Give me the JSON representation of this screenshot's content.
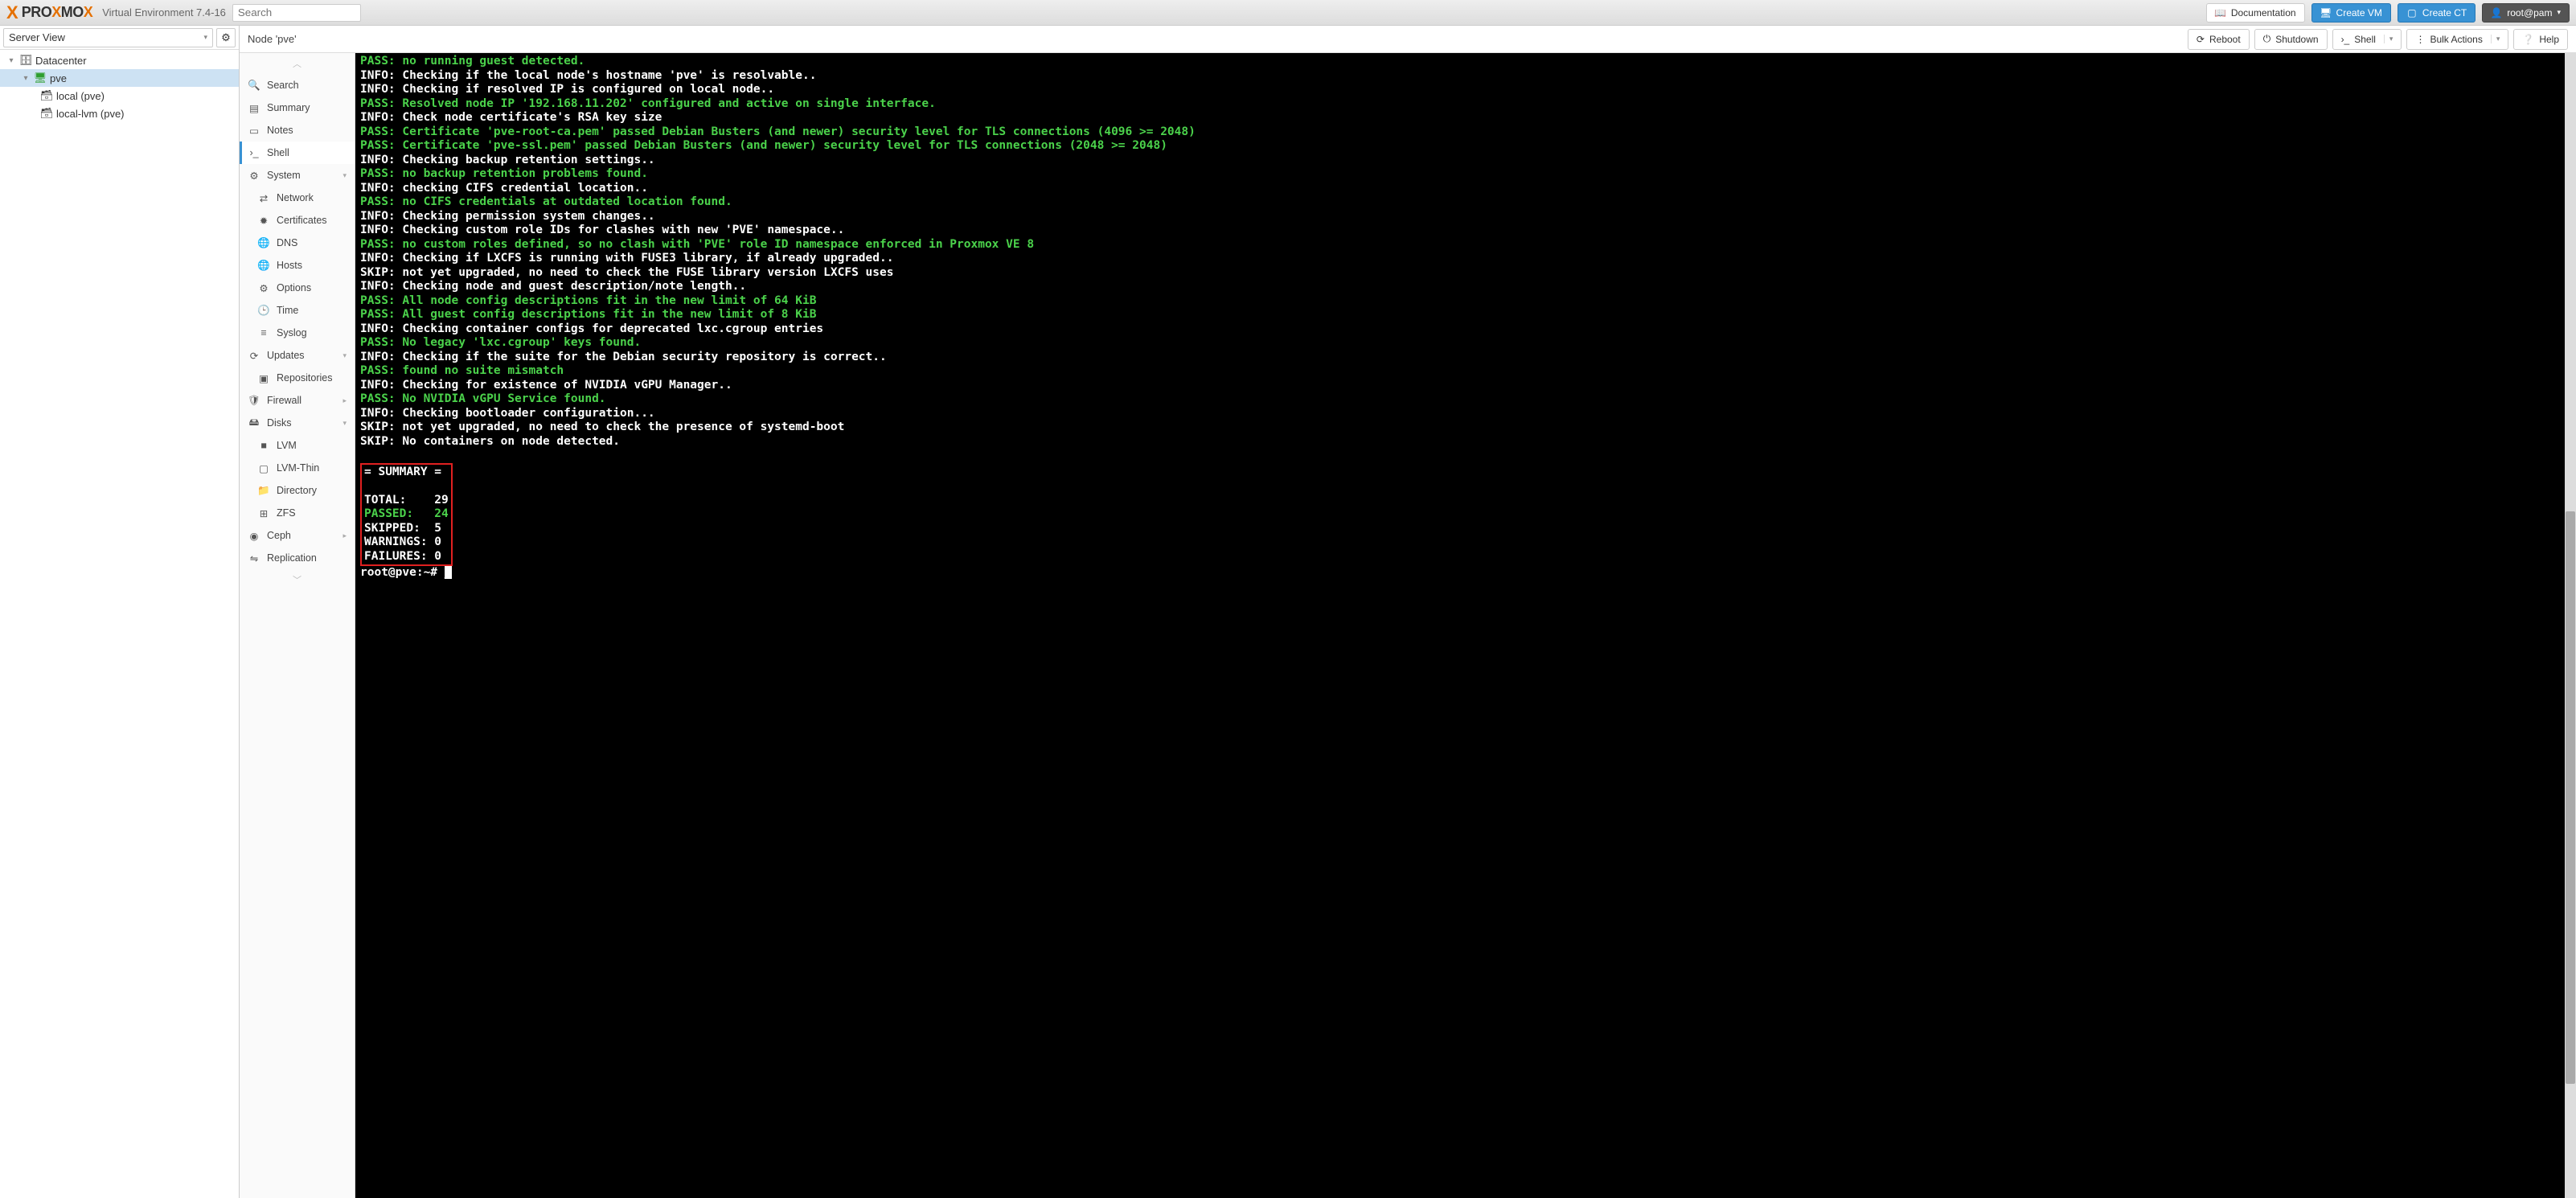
{
  "header": {
    "app_title": "Virtual Environment 7.4-16",
    "search_placeholder": "Search",
    "documentation": "Documentation",
    "create_vm": "Create VM",
    "create_ct": "Create CT",
    "user": "root@pam"
  },
  "server_view": {
    "label": "Server View"
  },
  "tree": {
    "datacenter": "Datacenter",
    "node": "pve",
    "local": "local (pve)",
    "local_lvm": "local-lvm (pve)"
  },
  "node_header": {
    "title": "Node 'pve'",
    "reboot": "Reboot",
    "shutdown": "Shutdown",
    "shell": "Shell",
    "bulk": "Bulk Actions",
    "help": "Help"
  },
  "sidemenu": {
    "search": "Search",
    "summary": "Summary",
    "notes": "Notes",
    "shell": "Shell",
    "system": "System",
    "network": "Network",
    "certificates": "Certificates",
    "dns": "DNS",
    "hosts": "Hosts",
    "options": "Options",
    "time": "Time",
    "syslog": "Syslog",
    "updates": "Updates",
    "repositories": "Repositories",
    "firewall": "Firewall",
    "disks": "Disks",
    "lvm": "LVM",
    "lvm_thin": "LVM-Thin",
    "directory": "Directory",
    "zfs": "ZFS",
    "ceph": "Ceph",
    "replication": "Replication"
  },
  "terminal": {
    "lines": [
      {
        "cls": "t-pass",
        "text": "PASS: no running guest detected."
      },
      {
        "cls": "t-info",
        "text": "INFO: Checking if the local node's hostname 'pve' is resolvable.."
      },
      {
        "cls": "t-info",
        "text": "INFO: Checking if resolved IP is configured on local node.."
      },
      {
        "cls": "t-pass",
        "text": "PASS: Resolved node IP '192.168.11.202' configured and active on single interface."
      },
      {
        "cls": "t-info",
        "text": "INFO: Check node certificate's RSA key size"
      },
      {
        "cls": "t-pass",
        "text": "PASS: Certificate 'pve-root-ca.pem' passed Debian Busters (and newer) security level for TLS connections (4096 >= 2048)"
      },
      {
        "cls": "t-pass",
        "text": "PASS: Certificate 'pve-ssl.pem' passed Debian Busters (and newer) security level for TLS connections (2048 >= 2048)"
      },
      {
        "cls": "t-info",
        "text": "INFO: Checking backup retention settings.."
      },
      {
        "cls": "t-pass",
        "text": "PASS: no backup retention problems found."
      },
      {
        "cls": "t-info",
        "text": "INFO: checking CIFS credential location.."
      },
      {
        "cls": "t-pass",
        "text": "PASS: no CIFS credentials at outdated location found."
      },
      {
        "cls": "t-info",
        "text": "INFO: Checking permission system changes.."
      },
      {
        "cls": "t-info",
        "text": "INFO: Checking custom role IDs for clashes with new 'PVE' namespace.."
      },
      {
        "cls": "t-pass",
        "text": "PASS: no custom roles defined, so no clash with 'PVE' role ID namespace enforced in Proxmox VE 8"
      },
      {
        "cls": "t-info",
        "text": "INFO: Checking if LXCFS is running with FUSE3 library, if already upgraded.."
      },
      {
        "cls": "t-skip",
        "text": "SKIP: not yet upgraded, no need to check the FUSE library version LXCFS uses"
      },
      {
        "cls": "t-info",
        "text": "INFO: Checking node and guest description/note length.."
      },
      {
        "cls": "t-pass",
        "text": "PASS: All node config descriptions fit in the new limit of 64 KiB"
      },
      {
        "cls": "t-pass",
        "text": "PASS: All guest config descriptions fit in the new limit of 8 KiB"
      },
      {
        "cls": "t-info",
        "text": "INFO: Checking container configs for deprecated lxc.cgroup entries"
      },
      {
        "cls": "t-pass",
        "text": "PASS: No legacy 'lxc.cgroup' keys found."
      },
      {
        "cls": "t-info",
        "text": "INFO: Checking if the suite for the Debian security repository is correct.."
      },
      {
        "cls": "t-pass",
        "text": "PASS: found no suite mismatch"
      },
      {
        "cls": "t-info",
        "text": "INFO: Checking for existence of NVIDIA vGPU Manager.."
      },
      {
        "cls": "t-pass",
        "text": "PASS: No NVIDIA vGPU Service found."
      },
      {
        "cls": "t-info",
        "text": "INFO: Checking bootloader configuration..."
      },
      {
        "cls": "t-skip",
        "text": "SKIP: not yet upgraded, no need to check the presence of systemd-boot"
      },
      {
        "cls": "t-skip",
        "text": "SKIP: No containers on node detected."
      }
    ],
    "summary_header": "= SUMMARY =",
    "summary_blank": "",
    "total": "TOTAL:    29",
    "passed": "PASSED:   24",
    "skipped": "SKIPPED:  5",
    "warnings": "WARNINGS: 0",
    "failures": "FAILURES: 0",
    "prompt": "root@pve:~# "
  }
}
